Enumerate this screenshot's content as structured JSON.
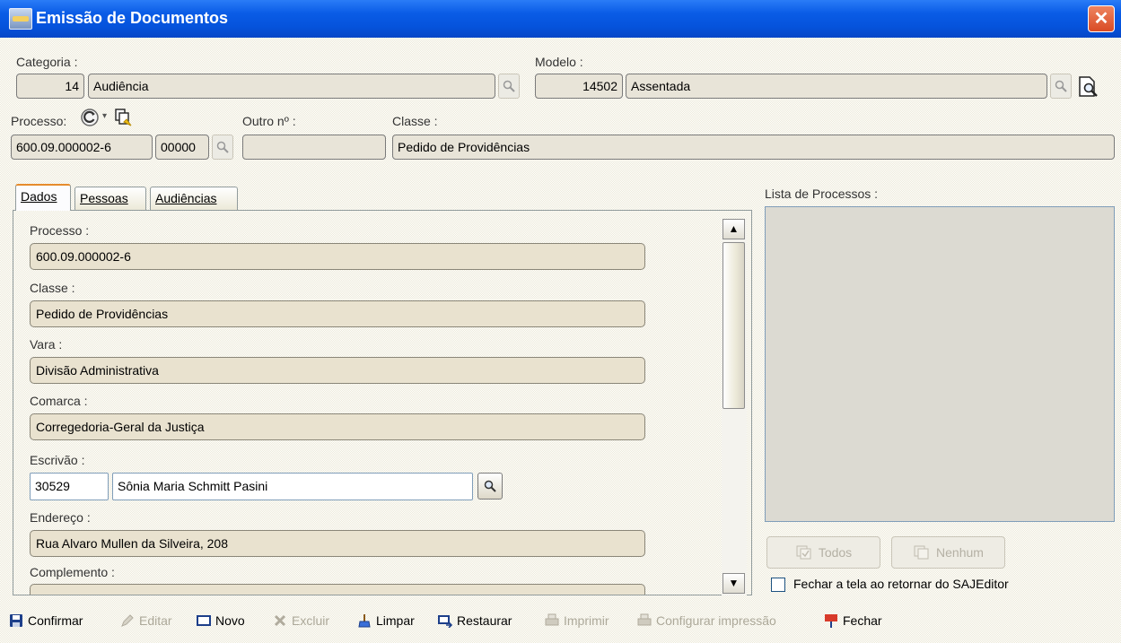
{
  "window": {
    "title": "Emissão de Documentos",
    "close_glyph": "✕"
  },
  "categoria": {
    "label": "Categoria :",
    "code": "14",
    "name": "Audiência"
  },
  "modelo": {
    "label": "Modelo :",
    "code": "14502",
    "name": "Assentada"
  },
  "processo": {
    "label": "Processo:",
    "number": "600.09.000002-6",
    "suffix": "00000"
  },
  "outro": {
    "label": "Outro nº :",
    "value": ""
  },
  "classe": {
    "label": "Classe :",
    "value": "Pedido de Providências"
  },
  "tabs": [
    {
      "label": "Dados",
      "active": true
    },
    {
      "label": "Pessoas",
      "active": false
    },
    {
      "label": "Audiências",
      "active": false
    }
  ],
  "dados": {
    "processo_label": "Processo :",
    "processo_value": "600.09.000002-6",
    "classe_label": "Classe :",
    "classe_value": "Pedido de Providências",
    "vara_label": "Vara :",
    "vara_value": "Divisão Administrativa",
    "comarca_label": "Comarca :",
    "comarca_value": "Corregedoria-Geral da Justiça",
    "escrivao_label": "Escrivão :",
    "escrivao_code": "30529",
    "escrivao_name": "Sônia Maria Schmitt Pasini",
    "endereco_label": "Endereço :",
    "endereco_value": "Rua Alvaro Mullen da Silveira, 208",
    "complemento_label": "Complemento :"
  },
  "lista": {
    "label": "Lista de Processos :"
  },
  "buttons": {
    "todos": "Todos",
    "nenhum": "Nenhum"
  },
  "checkbox": {
    "label": "Fechar a tela ao retornar do SAJEditor",
    "checked": false
  },
  "toolbar": {
    "confirmar": "Confirmar",
    "editar": "Editar",
    "novo": "Novo",
    "excluir": "Excluir",
    "limpar": "Limpar",
    "restaurar": "Restaurar",
    "imprimir": "Imprimir",
    "configurar": "Configurar impressão",
    "fechar": "Fechar"
  },
  "colors": {
    "title_bar": "#0a5ce6",
    "tab_highlight": "#e68b2c",
    "close_button": "#d94b24"
  }
}
